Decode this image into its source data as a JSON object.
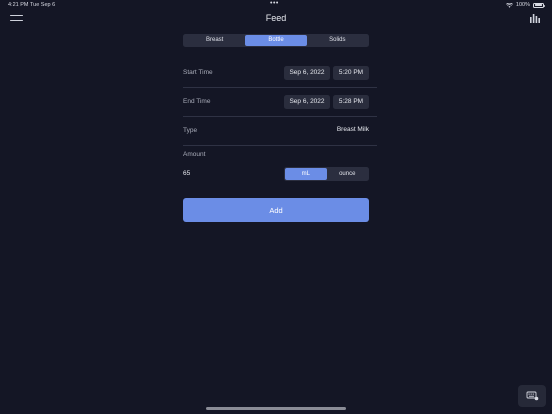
{
  "status": {
    "time": "4:21 PM",
    "date": "Tue Sep 6",
    "dots": "•••",
    "battery": "100%"
  },
  "nav": {
    "title": "Feed",
    "menu_icon": "hamburger-menu-icon",
    "chart_icon": "bar-chart-icon"
  },
  "feed_types": {
    "options": [
      "Breast",
      "Bottle",
      "Solids"
    ],
    "selected": "Bottle"
  },
  "form": {
    "start_time": {
      "label": "Start Time",
      "date": "Sep 6, 2022",
      "time": "5:20 PM"
    },
    "end_time": {
      "label": "End Time",
      "date": "Sep 6, 2022",
      "time": "5:28 PM"
    },
    "type": {
      "label": "Type",
      "value": "Breast Milk"
    },
    "amount": {
      "label": "Amount",
      "value": "65"
    },
    "units": {
      "options": [
        "mL",
        "ounce"
      ],
      "selected": "mL"
    }
  },
  "add_label": "Add",
  "colors": {
    "background": "#141625",
    "accent": "#6b8de6",
    "chip": "#2a2d3d"
  }
}
